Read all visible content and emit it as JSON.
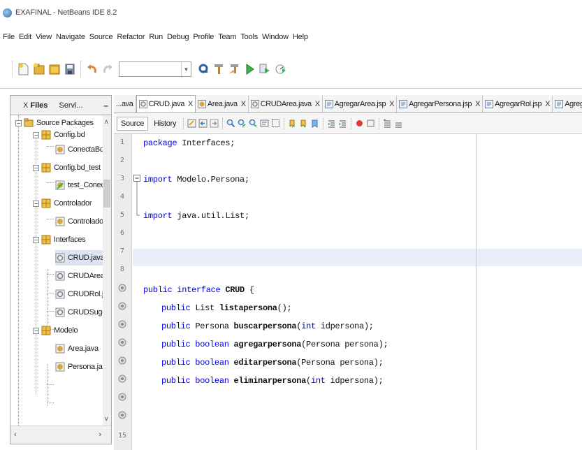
{
  "window": {
    "title": "EXAFINAL - NetBeans IDE 8.2"
  },
  "menubar": [
    "File",
    "Edit",
    "View",
    "Navigate",
    "Source",
    "Refactor",
    "Run",
    "Debug",
    "Profile",
    "Team",
    "Tools",
    "Window",
    "Help"
  ],
  "left_panel": {
    "tabs": {
      "close": "X",
      "files": "Files",
      "services": "Servi...",
      "minimize": "–"
    },
    "tree": [
      {
        "label": "Source Packages",
        "type": "root"
      },
      {
        "label": "Config.bd",
        "type": "package"
      },
      {
        "label": "ConectaBd.java",
        "type": "class"
      },
      {
        "label": "Config.bd_test",
        "type": "package"
      },
      {
        "label": "test_ConectaBd",
        "type": "test"
      },
      {
        "label": "Controlador",
        "type": "package"
      },
      {
        "label": "Controlador.jav",
        "type": "class"
      },
      {
        "label": "Interfaces",
        "type": "package"
      },
      {
        "label": "CRUD.java",
        "type": "interface",
        "selected": true
      },
      {
        "label": "CRUDArea.java",
        "type": "interface"
      },
      {
        "label": "CRUDRol.java",
        "type": "interface"
      },
      {
        "label": "CRUDSugerenci",
        "type": "interface"
      },
      {
        "label": "Modelo",
        "type": "package"
      },
      {
        "label": "Area.java",
        "type": "class"
      },
      {
        "label": "Persona.java",
        "type": "class"
      }
    ],
    "scroll": {
      "left": "‹",
      "right": "›",
      "up": "∧",
      "down": "∨"
    }
  },
  "editor": {
    "tabs": [
      {
        "label": "...ava",
        "close": ""
      },
      {
        "label": "CRUD.java",
        "close": "X",
        "active": true
      },
      {
        "label": "Area.java",
        "close": "X"
      },
      {
        "label": "CRUDArea.java",
        "close": "X"
      },
      {
        "label": "AgregarArea.jsp",
        "close": "X"
      },
      {
        "label": "AgregarPersona.jsp",
        "close": "X"
      },
      {
        "label": "AgregarRol.jsp",
        "close": "X"
      },
      {
        "label": "AgregarSugerencia.jsp",
        "close": "X"
      }
    ],
    "modes": {
      "source": "Source",
      "history": "History"
    },
    "line_numbers": [
      "1",
      "2",
      "3",
      "4",
      "5",
      "6",
      "7",
      "8",
      "15"
    ],
    "code": {
      "l1_kw": "package",
      "l1_rest": " Interfaces;",
      "l3_kw": "import",
      "l3_rest": " Modelo.Persona;",
      "l5_kw": "import",
      "l5_rest": " java.util.List;",
      "l9_kw": "public interface",
      "l9_name": " CRUD",
      "l9_rest": " {",
      "m1_kw": "public",
      "m1_type": " List ",
      "m1_name": "listapersona",
      "m1_rest": "();",
      "m2_kw": "public",
      "m2_type": " Persona ",
      "m2_name": "buscarpersona",
      "m2_open": "(",
      "m2_pkw": "int",
      "m2_rest": " idpersona);",
      "m3_kw": "public boolean",
      "m3_name": " agregarpersona",
      "m3_rest": "(Persona persona);",
      "m4_kw": "public boolean",
      "m4_name": " editarpersona",
      "m4_rest": "(Persona persona);",
      "m5_kw": "public boolean",
      "m5_name": " eliminarpersona",
      "m5_open": "(",
      "m5_pkw": "int",
      "m5_rest": " idpersona);"
    }
  },
  "colors": {
    "keyword": "#0000e6",
    "current_line": "#e9eff8",
    "right_margin": "#f0b8b8",
    "selection": "#dce4f1"
  }
}
